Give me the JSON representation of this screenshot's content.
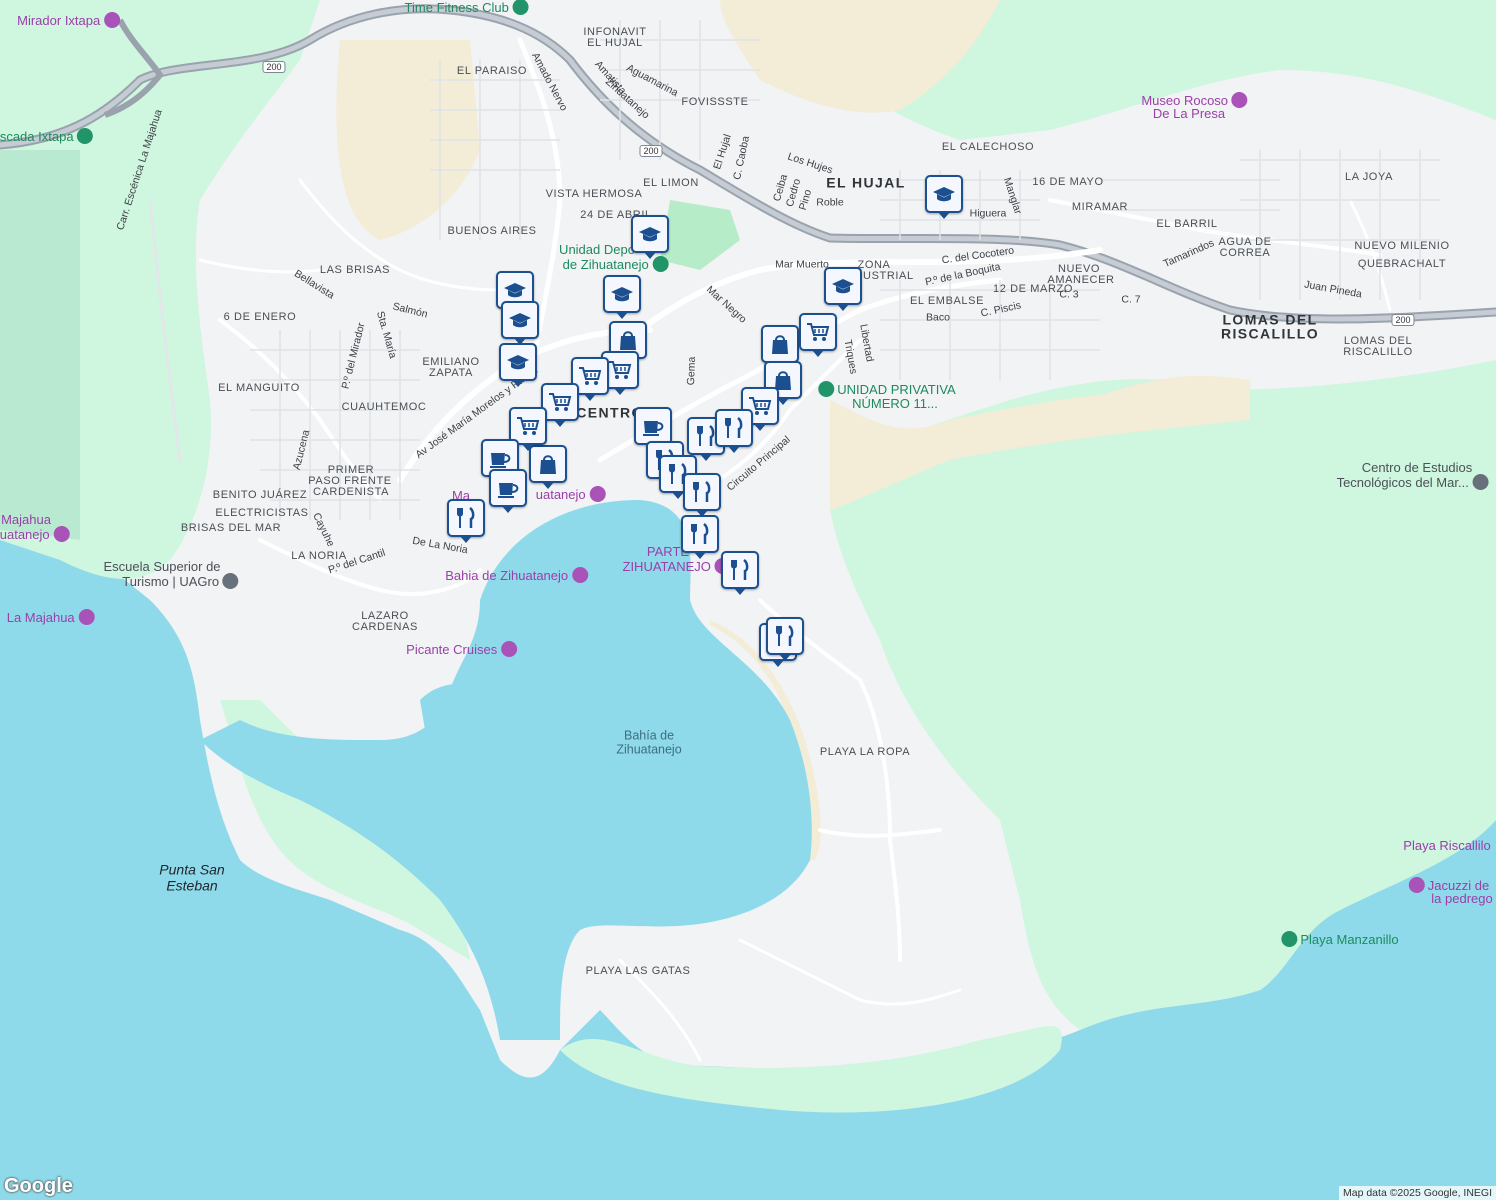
{
  "map": {
    "colors": {
      "water": "#8fdaea",
      "land": "#f1f3f4",
      "park": "#cff6df",
      "hill": "#b9ead1",
      "sand": "#f3ecd6",
      "road": "#ffffff",
      "highway": "#9aa3ad",
      "pin_border": "#1b4f8f",
      "poi_purple": "#9b3fa9",
      "poi_green": "#1e8a5e"
    },
    "neighborhoods": [
      "INFONAVIT",
      "EL HUJAL",
      "EL PARAISO",
      "FOVISSSTE",
      "EL LIMON",
      "VISTA HERMOSA",
      "24 DE ABRIL",
      "BUENOS AIRES",
      "LAS BRISAS",
      "6 DE ENERO",
      "EL MANGUITO",
      "CUAUHTEMOC",
      "EMILIANO",
      "ZAPATA",
      "PRIMER",
      "PASO FRENTE",
      "CARDENISTA",
      "BENITO JUÁREZ",
      "ELECTRICISTAS",
      "BRISAS DEL MAR",
      "LA NORIA",
      "LAZARO",
      "CARDENAS",
      "EL CALECHOSO",
      "16 DE MAYO",
      "MIRAMAR",
      "EL BARRIL",
      "LA JOYA",
      "AGUA DE",
      "CORREA",
      "NUEVO MILENIO",
      "QUEBRACHALT",
      "LOMAS DEL",
      "RISCALILLO",
      "ZONA",
      "INDUSTRIAL",
      "EL EMBALSE",
      "12 DE MARZO",
      "NUEVO",
      "AMANECER",
      "PLAYA LA ROPA",
      "PLAYA LAS GATAS"
    ],
    "big_labels": [
      "EL HUJAL",
      "LOMAS DEL",
      "RISCALILLO",
      "CENTRO"
    ],
    "streets": [
      "Amado Nervo",
      "Aguamarina",
      "Amatista",
      "Zihuatanejo",
      "El Hujal",
      "C. Caoba",
      "Los Hujes",
      "Ceiba",
      "Cedro",
      "Pino",
      "Roble",
      "Higuera",
      "Manglar",
      "C. del Cocotero",
      "P.º de la Boquita",
      "Mar Muerto",
      "Mar Negro",
      "Gema",
      "Libertad",
      "Triques",
      "Baco",
      "C. Piscis",
      "C. 3",
      "C. 7",
      "Tamarindos",
      "Juan Pineda",
      "Bellavista",
      "Salmón",
      "Sta. María",
      "P.º del Mirador",
      "Av José María Morelos y Pavón",
      "Azucena",
      "Cayuhe",
      "P.º del Cantil",
      "De La Noria",
      "Circuito Principal",
      "Carr. Escénica La Majahua"
    ],
    "water_labels": [
      "Bahía de",
      "Zihuatanejo"
    ],
    "capes": [
      "Punta San",
      "Esteban"
    ],
    "highway_shields": [
      "200",
      "200",
      "200"
    ],
    "pois": [
      {
        "name": "Mirador Ixtapa",
        "kind": "purple",
        "icon": "camera-icon"
      },
      {
        "name": "Time Fitness Club",
        "kind": "green",
        "icon": "dumbbell-icon"
      },
      {
        "name": "Museo Rocoso",
        "kind": "purple",
        "icon": "camera-icon"
      },
      {
        "name": "De La Presa",
        "kind": "purple",
        "icon": ""
      },
      {
        "name": "scada Ixtapa",
        "kind": "green",
        "icon": "tree-icon"
      },
      {
        "name": "Unidad Depo",
        "kind": "green",
        "icon": ""
      },
      {
        "name": "de Zihuatanejo",
        "kind": "green",
        "icon": "park-icon"
      },
      {
        "name": "UNIDAD PRIVATIVA",
        "kind": "green",
        "icon": "tree-icon"
      },
      {
        "name": "NÚMERO 11...",
        "kind": "green",
        "icon": ""
      },
      {
        "name": "Centro de Estudios",
        "kind": "gray",
        "icon": ""
      },
      {
        "name": "Tecnológicos del Mar...",
        "kind": "gray",
        "icon": "school-icon"
      },
      {
        "name": "Majahua",
        "kind": "purple",
        "icon": ""
      },
      {
        "name": "uatanejo",
        "kind": "purple",
        "icon": "camera-icon"
      },
      {
        "name": "Escuela Superior de",
        "kind": "gray",
        "icon": ""
      },
      {
        "name": "Turismo | UAGro",
        "kind": "gray",
        "icon": "school-icon"
      },
      {
        "name": "La Majahua",
        "kind": "purple",
        "icon": "camera-icon"
      },
      {
        "name": "Bahia de Zihuatanejo",
        "kind": "purple",
        "icon": "camera-icon"
      },
      {
        "name": "Picante Cruises",
        "kind": "purple",
        "icon": "camera-icon"
      },
      {
        "name": "PARTE",
        "kind": "purple",
        "icon": ""
      },
      {
        "name": "ZIHUATANEJO",
        "kind": "purple",
        "icon": "camera-icon"
      },
      {
        "name": "Ma",
        "kind": "purple",
        "icon": ""
      },
      {
        "name": "uatanejo",
        "kind": "purple",
        "icon": "camera-icon"
      },
      {
        "name": "Playa Riscallilo",
        "kind": "purple",
        "icon": ""
      },
      {
        "name": "Jacuzzi de",
        "kind": "purple",
        "icon": "camera-icon"
      },
      {
        "name": "la pedrego",
        "kind": "purple",
        "icon": ""
      },
      {
        "name": "Playa Manzanillo",
        "kind": "green",
        "icon": "tree-icon"
      }
    ],
    "markers": [
      {
        "type": "school",
        "icon": "graduation-cap-icon"
      },
      {
        "type": "school",
        "icon": "graduation-cap-icon"
      },
      {
        "type": "school",
        "icon": "graduation-cap-icon"
      },
      {
        "type": "school",
        "icon": "graduation-cap-icon"
      },
      {
        "type": "school",
        "icon": "graduation-cap-icon"
      },
      {
        "type": "school",
        "icon": "graduation-cap-icon"
      },
      {
        "type": "school",
        "icon": "graduation-cap-icon"
      },
      {
        "type": "shopping",
        "icon": "shopping-bag-icon"
      },
      {
        "type": "shopping",
        "icon": "shopping-bag-icon"
      },
      {
        "type": "shopping",
        "icon": "shopping-bag-icon"
      },
      {
        "type": "shopping",
        "icon": "shopping-bag-icon"
      },
      {
        "type": "grocery",
        "icon": "shopping-cart-icon"
      },
      {
        "type": "grocery",
        "icon": "shopping-cart-icon"
      },
      {
        "type": "grocery",
        "icon": "shopping-cart-icon"
      },
      {
        "type": "grocery",
        "icon": "shopping-cart-icon"
      },
      {
        "type": "grocery",
        "icon": "shopping-cart-icon"
      },
      {
        "type": "grocery",
        "icon": "shopping-cart-icon"
      },
      {
        "type": "cafe",
        "icon": "coffee-cup-icon"
      },
      {
        "type": "cafe",
        "icon": "coffee-cup-icon"
      },
      {
        "type": "cafe",
        "icon": "coffee-cup-icon"
      },
      {
        "type": "restaurant",
        "icon": "fork-knife-icon"
      },
      {
        "type": "restaurant",
        "icon": "fork-knife-icon"
      },
      {
        "type": "restaurant",
        "icon": "fork-knife-icon"
      },
      {
        "type": "restaurant",
        "icon": "fork-knife-icon"
      },
      {
        "type": "restaurant",
        "icon": "fork-knife-icon"
      },
      {
        "type": "restaurant",
        "icon": "fork-knife-icon"
      },
      {
        "type": "restaurant",
        "icon": "fork-knife-icon"
      },
      {
        "type": "restaurant",
        "icon": "fork-knife-icon"
      },
      {
        "type": "restaurant",
        "icon": "fork-knife-icon"
      },
      {
        "type": "restaurant",
        "icon": "fork-knife-icon"
      }
    ],
    "attribution": "Map data ©2025 Google, INEGI",
    "logo": "Google"
  }
}
